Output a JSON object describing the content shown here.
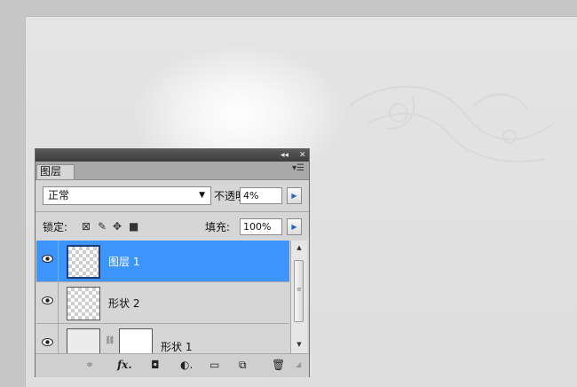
{
  "panel": {
    "tab_label": "图层",
    "titlebar_controls": {
      "collapse": "◂◂",
      "close": "✕"
    },
    "menu_icon": "panel-menu-icon"
  },
  "blend": {
    "mode": "正常"
  },
  "opacity": {
    "label": "不透明度:",
    "value": "4%"
  },
  "lock": {
    "label": "锁定:",
    "icons": [
      "lock-transparent-icon",
      "lock-paint-icon",
      "lock-position-icon",
      "lock-all-icon"
    ]
  },
  "fill": {
    "label": "填充:",
    "value": "100%"
  },
  "layers": [
    {
      "name": "图层 1",
      "selected": true,
      "visible": true,
      "thumbnail": "transparent"
    },
    {
      "name": "形状 2",
      "selected": false,
      "visible": true,
      "thumbnail": "transparent"
    },
    {
      "name": "形状 1",
      "selected": false,
      "visible": true,
      "thumbnail": "shape-with-mask"
    }
  ],
  "footer_icons": [
    "link-layers-icon",
    "fx-icon",
    "add-mask-icon",
    "adjustment-layer-icon",
    "group-icon",
    "new-layer-icon",
    "delete-layer-icon"
  ],
  "colors": {
    "selection": "#3d95fb",
    "panel_bg": "#d6d6d6",
    "titlebar": "#3c3c3c"
  }
}
